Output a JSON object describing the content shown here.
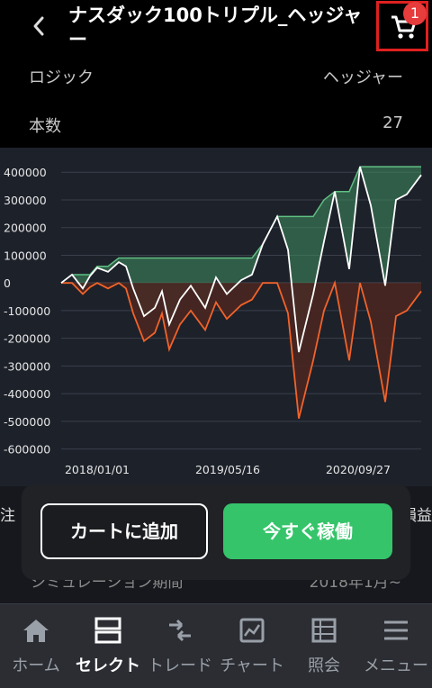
{
  "header": {
    "title": "ナスダック100トリプル_ヘッジャー",
    "cart_badge": "1"
  },
  "info_rows": [
    {
      "label": "ロジック",
      "value": "ヘッジャー"
    },
    {
      "label": "本数",
      "value": "27"
    }
  ],
  "chart_data": {
    "type": "area",
    "title": "",
    "xlabel": "",
    "ylabel": "",
    "ylim": [
      -650000,
      430000
    ],
    "yticks": [
      "400000",
      "300000",
      "200000",
      "100000",
      "0",
      "-100000",
      "-200000",
      "-300000",
      "-400000",
      "-500000",
      "-600000"
    ],
    "xticks": [
      "2018/01/01",
      "2019/05/16",
      "2020/09/27"
    ],
    "x": [
      0,
      3,
      6,
      8,
      10,
      13,
      16,
      18,
      20,
      23,
      26,
      28,
      30,
      33,
      36,
      40,
      43,
      46,
      50,
      53,
      56,
      60,
      63,
      66,
      70,
      73,
      76,
      80,
      83,
      86,
      90,
      93,
      96,
      100
    ],
    "series": [
      {
        "name": "cumulative",
        "color": "#ffffff",
        "values": [
          0,
          30000,
          -20000,
          25000,
          55000,
          40000,
          75000,
          60000,
          -20000,
          -120000,
          -90000,
          -30000,
          -150000,
          -60000,
          -10000,
          -90000,
          20000,
          -40000,
          10000,
          30000,
          140000,
          240000,
          120000,
          -250000,
          -40000,
          150000,
          330000,
          50000,
          420000,
          280000,
          -10000,
          300000,
          320000,
          390000
        ]
      },
      {
        "name": "peak",
        "color": "#3f8f5f",
        "values": [
          0,
          30000,
          30000,
          30000,
          60000,
          60000,
          90000,
          90000,
          90000,
          90000,
          90000,
          90000,
          90000,
          90000,
          90000,
          90000,
          90000,
          90000,
          90000,
          90000,
          140000,
          240000,
          240000,
          240000,
          240000,
          300000,
          330000,
          330000,
          420000,
          420000,
          420000,
          420000,
          420000,
          420000
        ]
      },
      {
        "name": "drawdown",
        "color": "#f0632b",
        "values": [
          0,
          0,
          -40000,
          -15000,
          0,
          -20000,
          0,
          -20000,
          -110000,
          -210000,
          -180000,
          -110000,
          -240000,
          -150000,
          -100000,
          -170000,
          -70000,
          -130000,
          -80000,
          -60000,
          0,
          0,
          -110000,
          -490000,
          -280000,
          -100000,
          0,
          -280000,
          0,
          -140000,
          -430000,
          -120000,
          -100000,
          -30000
        ]
      }
    ]
  },
  "peek": {
    "left": "注",
    "right": "損益",
    "sim_label": "シミュレーション期間",
    "sim_value": "2018年1月~"
  },
  "popup": {
    "add_cart": "カートに追加",
    "start_now": "今すぐ稼働"
  },
  "tabs": [
    {
      "label": "ホーム",
      "icon": "home-icon"
    },
    {
      "label": "セレクト",
      "icon": "select-icon"
    },
    {
      "label": "トレード",
      "icon": "trade-icon"
    },
    {
      "label": "チャート",
      "icon": "chart-icon"
    },
    {
      "label": "照会",
      "icon": "list-icon"
    },
    {
      "label": "メニュー",
      "icon": "menu-icon"
    }
  ],
  "colors": {
    "accent_green": "#35c46a",
    "badge_red": "#e63c3c",
    "peak_fill": "#3f8f5f",
    "drawdown_line": "#f0632b"
  }
}
